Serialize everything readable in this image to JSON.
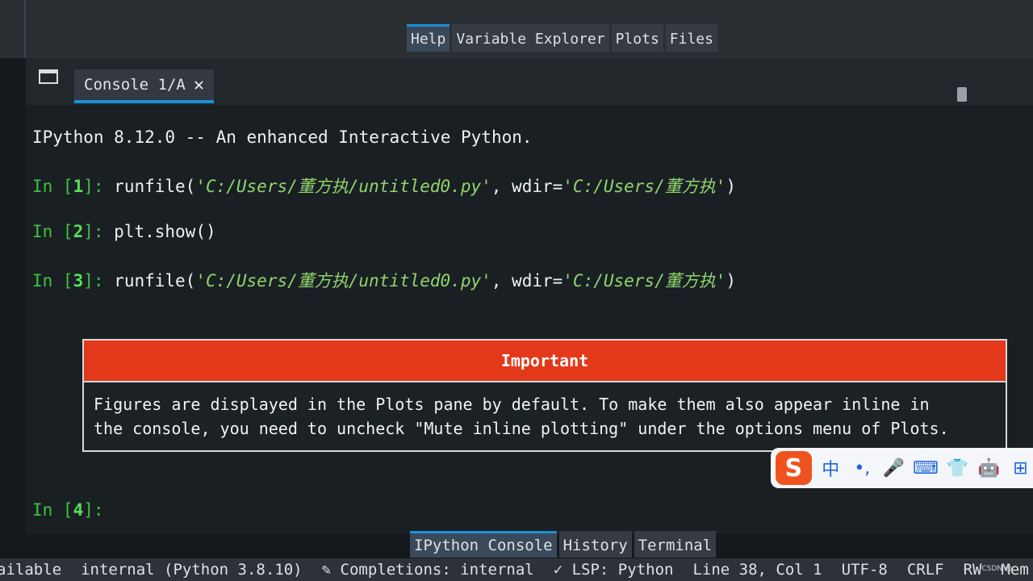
{
  "top_tabs": [
    {
      "label": "Help",
      "active": true
    },
    {
      "label": "Variable Explorer",
      "active": false
    },
    {
      "label": "Plots",
      "active": false
    },
    {
      "label": "Files",
      "active": false
    }
  ],
  "console_tab": {
    "label": "Console 1/A",
    "close": "✕"
  },
  "banner": "IPython 8.12.0 -- An enhanced Interactive Python.",
  "cells": [
    {
      "prompt_in": "In [",
      "num": "1",
      "prompt_end": "]: ",
      "code_pre": "runfile(",
      "arg1": "'C:/Users/董方执/untitled0.py'",
      "code_mid": ", wdir=",
      "arg2": "'C:/Users/董方执'",
      "code_post": ")"
    },
    {
      "prompt_in": "In [",
      "num": "2",
      "prompt_end": "]: ",
      "code": "plt.show()"
    },
    {
      "prompt_in": "In [",
      "num": "3",
      "prompt_end": "]: ",
      "code_pre": "runfile(",
      "arg1": "'C:/Users/董方执/untitled0.py'",
      "code_mid": ", wdir=",
      "arg2": "'C:/Users/董方执'",
      "code_post": ")"
    },
    {
      "prompt_in": "In [",
      "num": "4",
      "prompt_end": "]:"
    }
  ],
  "important": {
    "title": "Important",
    "line1": "Figures are displayed in the Plots pane by default. To make them also appear inline in",
    "line2": "the console, you need to uncheck \"Mute inline plotting\" under the options menu of Plots."
  },
  "ime": {
    "logo": "S",
    "items": [
      "中",
      "•,",
      "🎤",
      "⌨",
      "👕",
      "🤖",
      "⊞"
    ]
  },
  "bottom_tabs": [
    {
      "label": "IPython Console",
      "active": true
    },
    {
      "label": "History",
      "active": false
    },
    {
      "label": "Terminal",
      "active": false
    }
  ],
  "status": {
    "kernel": "ailable",
    "interpreter": "internal (Python 3.8.10)",
    "completions": "✎ Completions: internal",
    "lsp": "✓ LSP: Python",
    "position": "Line 38, Col 1",
    "encoding": "UTF-8",
    "eol": "CRLF",
    "rw": "RW",
    "mem": "Mem"
  },
  "watermark": "CSDN @"
}
